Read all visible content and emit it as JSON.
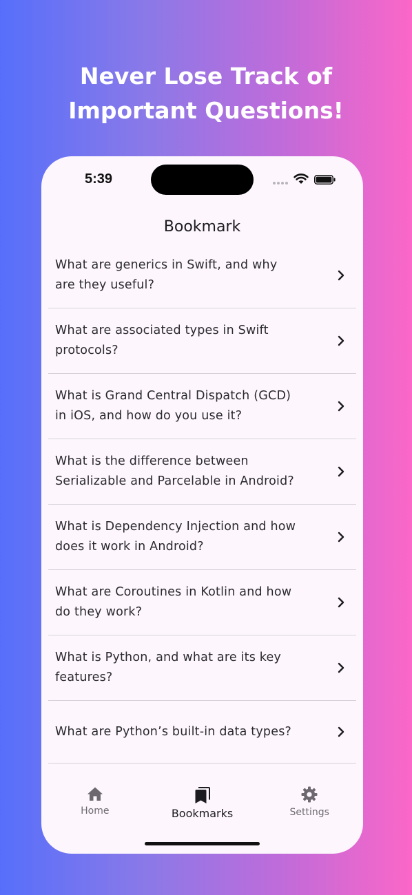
{
  "promo": {
    "headline_line1": "Never Lose Track of",
    "headline_line2": "Important Questions!"
  },
  "status_bar": {
    "time": "5:39"
  },
  "screen": {
    "title": "Bookmark"
  },
  "bookmarks": [
    {
      "line1": "What are generics in Swift, and why",
      "line2": "are they useful?"
    },
    {
      "line1": "What are associated types in Swift",
      "line2": "protocols?"
    },
    {
      "line1": "What is Grand Central Dispatch (GCD)",
      "line2": "in iOS, and how do you use it?"
    },
    {
      "line1": "What is the difference between",
      "line2": "Serializable and Parcelable in Android?"
    },
    {
      "line1": "What is Dependency Injection and how",
      "line2": "does it work in Android?"
    },
    {
      "line1": "What are Coroutines in Kotlin and how",
      "line2": "do they work?"
    },
    {
      "line1": "What is Python, and what are its key",
      "line2": "features?"
    },
    {
      "line1": "What are Python’s built-in data types?",
      "line2": ""
    }
  ],
  "tabs": [
    {
      "label": "Home",
      "icon": "home-icon",
      "active": false
    },
    {
      "label": "Bookmarks",
      "icon": "bookmarks-icon",
      "active": true
    },
    {
      "label": "Settings",
      "icon": "gear-icon",
      "active": false
    }
  ],
  "colors": {
    "gradient_start": "#566ffb",
    "gradient_end": "#fb67c7",
    "screen_bg": "#fdf7fd",
    "text": "#2b2930"
  }
}
